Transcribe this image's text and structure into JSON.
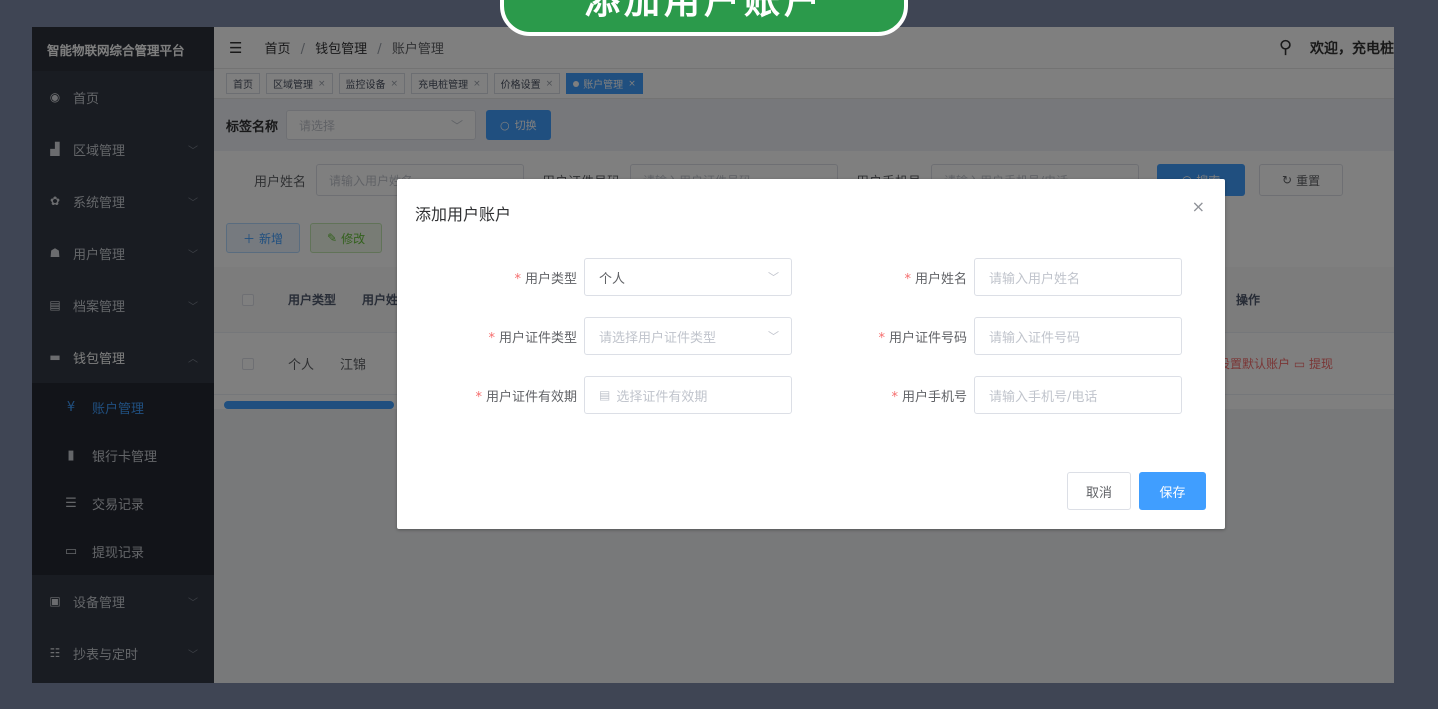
{
  "banner": {
    "title": "添加用户账户"
  },
  "sidebar": {
    "brand": "智能物联网综合管理平台",
    "items": [
      {
        "label": "首页",
        "icon": "dashboard-icon",
        "glyph": "◉"
      },
      {
        "label": "区域管理",
        "icon": "area-icon",
        "glyph": "▟"
      },
      {
        "label": "系统管理",
        "icon": "gear-icon",
        "glyph": "✿"
      },
      {
        "label": "用户管理",
        "icon": "users-icon",
        "glyph": "☗"
      },
      {
        "label": "档案管理",
        "icon": "archive-icon",
        "glyph": "▤"
      },
      {
        "label": "钱包管理",
        "icon": "wallet-icon",
        "glyph": "▬"
      }
    ],
    "subitems": [
      {
        "label": "账户管理",
        "icon": "yen-icon",
        "glyph": "¥"
      },
      {
        "label": "银行卡管理",
        "icon": "bar-chart-icon",
        "glyph": "▮"
      },
      {
        "label": "交易记录",
        "icon": "list-icon",
        "glyph": "☰"
      },
      {
        "label": "提现记录",
        "icon": "card-icon",
        "glyph": "▭"
      }
    ],
    "bottom_items": [
      {
        "label": "设备管理",
        "icon": "device-icon",
        "glyph": "▣"
      },
      {
        "label": "抄表与定时",
        "icon": "meter-icon",
        "glyph": "☷"
      }
    ]
  },
  "topbar": {
    "breadcrumb": [
      "首页",
      "钱包管理",
      "账户管理"
    ],
    "separator": "/",
    "welcome": "欢迎，充电桩"
  },
  "tags": [
    {
      "label": "首页"
    },
    {
      "label": "区域管理"
    },
    {
      "label": "监控设备"
    },
    {
      "label": "充电桩管理"
    },
    {
      "label": "价格设置"
    },
    {
      "label": "账户管理"
    }
  ],
  "labelrow": {
    "label": "标签名称",
    "select_placeholder": "请选择",
    "switch_button": "切换"
  },
  "filter": {
    "name_label": "用户姓名",
    "name_placeholder": "请输入用户姓名",
    "id_label": "用户证件号码",
    "id_placeholder": "请输入用户证件号码",
    "phone_label": "用户手机号",
    "phone_placeholder": "请输入用户手机号/电话",
    "search_button": "搜索",
    "reset_button": "重置"
  },
  "actions": {
    "add_button": "新增",
    "edit_button": "修改"
  },
  "table": {
    "headers": [
      "用户类型",
      "用户姓名"
    ],
    "ops_header": "操作",
    "rows": [
      {
        "type": "个人",
        "name": "江锦",
        "ops": "设置默认账户  ▭ 提现"
      }
    ]
  },
  "modal": {
    "title": "添加用户账户",
    "fields": {
      "user_type": {
        "label": "用户类型",
        "value": "个人"
      },
      "user_name": {
        "label": "用户姓名",
        "placeholder": "请输入用户姓名"
      },
      "id_type": {
        "label": "用户证件类型",
        "placeholder": "请选择用户证件类型"
      },
      "id_number": {
        "label": "用户证件号码",
        "placeholder": "请输入证件号码"
      },
      "id_validity": {
        "label": "用户证件有效期",
        "placeholder": "选择证件有效期"
      },
      "phone": {
        "label": "用户手机号",
        "placeholder": "请输入手机号/电话"
      }
    },
    "cancel_button": "取消",
    "save_button": "保存"
  },
  "colors": {
    "primary": "#409eff",
    "sidebar": "#333944",
    "banner": "#2b9a4b",
    "danger": "#f56c6c"
  }
}
